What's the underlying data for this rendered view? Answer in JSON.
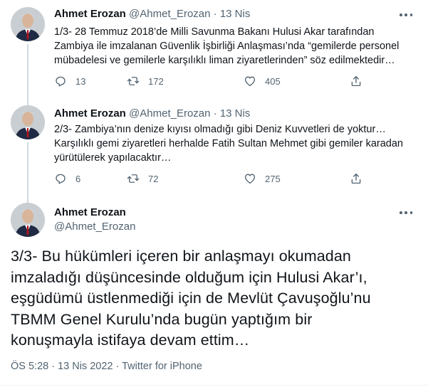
{
  "tweets": [
    {
      "name": "Ahmet Erozan",
      "handle": "@Ahmet_Erozan",
      "separator": "·",
      "date": "13 Nis",
      "lines": [
        "1/3- 28 Temmuz 2018’de Milli Savunma Bakanı Hulusi Akar tarafından",
        "Zambiya ile imzalanan Güvenlik İşbirliği Anlaşması’nda “gemilerde personel",
        "mübadelesi ve gemilerle karşılıklı liman ziyaretlerinden” söz edilmektedir…"
      ],
      "replies": "13",
      "retweets": "172",
      "likes": "405"
    },
    {
      "name": "Ahmet Erozan",
      "handle": "@Ahmet_Erozan",
      "separator": "·",
      "date": "13 Nis",
      "lines": [
        "2/3- Zambiya’nın denize kıyısı olmadığı gibi Deniz Kuvvetleri de yoktur…",
        "Karşılıklı gemi ziyaretleri herhalde Fatih Sultan Mehmet gibi gemiler karadan",
        "yürütülerek yapılacaktır…"
      ],
      "replies": "6",
      "retweets": "72",
      "likes": "275"
    }
  ],
  "main_tweet": {
    "name": "Ahmet Erozan",
    "handle": "@Ahmet_Erozan",
    "lines": [
      "3/3- Bu hükümleri içeren bir anlaşmayı okumadan",
      "imzaladığı düşüncesinde olduğum için Hulusi Akar’ı,",
      "eşgüdümü üstlenmediği için de Mevlüt Çavuşoğlu’nu",
      "TBMM Genel Kurulu’nda bugün yaptığım bir",
      "konuşmayla istifaya devam ettim…"
    ],
    "meta": "ÖS 5:28 · 13 Nis 2022 · Twitter for iPhone"
  },
  "icons": {
    "reply": "reply-icon",
    "retweet": "retweet-icon",
    "like": "heart-icon",
    "share": "share-icon",
    "more": "more-options-icon"
  },
  "colors": {
    "text": "#0f1419",
    "muted": "#536471",
    "thread_line": "#cfd9de"
  }
}
